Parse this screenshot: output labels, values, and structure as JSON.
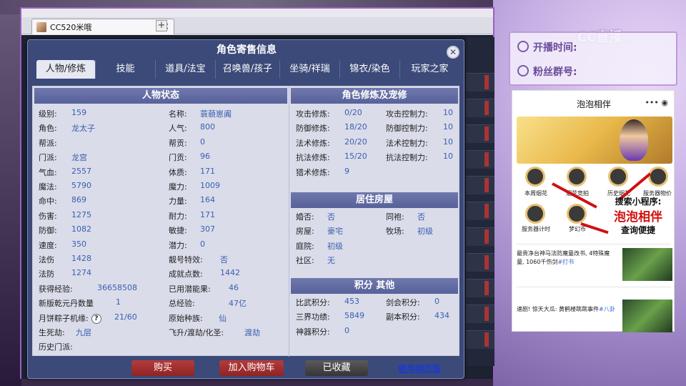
{
  "browser": {
    "tab_title": "CC520米哦",
    "close_glyph": "×",
    "new_tab_glyph": "+"
  },
  "dialog": {
    "title": "角色寄售信息",
    "close_glyph": "✕",
    "tabs": [
      "人物/修炼",
      "技能",
      "道具/法宝",
      "召唤兽/孩子",
      "坐骑/祥瑞",
      "锦衣/染色",
      "玩家之家"
    ],
    "active_tab": 0
  },
  "status": {
    "title": "人物状态",
    "left": [
      {
        "label": "级别:",
        "value": "159"
      },
      {
        "label": "角色:",
        "value": "龙太子"
      },
      {
        "label": "帮派:",
        "value": ""
      },
      {
        "label": "门派:",
        "value": "龙宫"
      },
      {
        "label": "气血:",
        "value": "2557"
      },
      {
        "label": "魔法:",
        "value": "5790"
      },
      {
        "label": "命中:",
        "value": "869"
      },
      {
        "label": "伤害:",
        "value": "1275"
      },
      {
        "label": "防御:",
        "value": "1082"
      },
      {
        "label": "速度:",
        "value": "350"
      },
      {
        "label": "法伤",
        "value": "1428"
      },
      {
        "label": "法防",
        "value": "1274"
      },
      {
        "label": "获得经验:",
        "value": "36658508"
      },
      {
        "label": "新版乾元丹数量",
        "value": "1"
      },
      {
        "label": "月饼粽子机缘:",
        "value": "21/60"
      },
      {
        "label": "生死劫:",
        "value": "九层"
      },
      {
        "label": "历史门派:",
        "value": ""
      }
    ],
    "right": [
      {
        "label": "名称:",
        "value": "蓑藐崽阗"
      },
      {
        "label": "人气:",
        "value": "800"
      },
      {
        "label": "帮贡:",
        "value": "0"
      },
      {
        "label": "门贡:",
        "value": "96"
      },
      {
        "label": "体质:",
        "value": "171"
      },
      {
        "label": "魔力:",
        "value": "1009"
      },
      {
        "label": "力量:",
        "value": "164"
      },
      {
        "label": "耐力:",
        "value": "171"
      },
      {
        "label": "敏捷:",
        "value": "307"
      },
      {
        "label": "潜力:",
        "value": "0"
      },
      {
        "label": "靓号特效:",
        "value": "否"
      },
      {
        "label": "成就点数:",
        "value": "1442"
      },
      {
        "label": "已用潜能果:",
        "value": "46"
      },
      {
        "label": "总经验:",
        "value": "47亿"
      },
      {
        "label": "原始种族:",
        "value": "仙"
      },
      {
        "label": "飞升/渡劫/化圣:",
        "value": "渡劫"
      }
    ],
    "help_glyph": "?"
  },
  "cultivation": {
    "title": "角色修炼及宠修",
    "left": [
      {
        "label": "攻击修炼:",
        "value": "0/20"
      },
      {
        "label": "防御修炼:",
        "value": "18/20"
      },
      {
        "label": "法术修炼:",
        "value": "20/20"
      },
      {
        "label": "抗法修炼:",
        "value": "15/20"
      },
      {
        "label": "猎术修炼:",
        "value": "9"
      }
    ],
    "right": [
      {
        "label": "攻击控制力:",
        "value": "10"
      },
      {
        "label": "防御控制力:",
        "value": "10"
      },
      {
        "label": "法术控制力:",
        "value": "10"
      },
      {
        "label": "抗法控制力:",
        "value": "10"
      }
    ]
  },
  "housing": {
    "title": "居住房屋",
    "left": [
      {
        "label": "婚否:",
        "value": "否"
      },
      {
        "label": "房屋:",
        "value": "豪宅"
      },
      {
        "label": "庭院:",
        "value": "初级"
      },
      {
        "label": "社区:",
        "value": "无"
      }
    ],
    "right": [
      {
        "label": "同袍:",
        "value": "否"
      },
      {
        "label": "牧场:",
        "value": "初级"
      }
    ]
  },
  "points": {
    "title": "积分 其他",
    "left": [
      {
        "label": "比武积分:",
        "value": "453"
      },
      {
        "label": "三界功绩:",
        "value": "5849"
      },
      {
        "label": "神器积分:",
        "value": "0"
      }
    ],
    "right": [
      {
        "label": "剑会积分:",
        "value": "0"
      },
      {
        "label": "副本积分:",
        "value": "434"
      }
    ]
  },
  "actions": {
    "buy": "购买",
    "cart": "加入购物车",
    "fav": "已收藏",
    "web": "使用网页版"
  },
  "overlay": {
    "logo": "CC直播",
    "live_time_label": "开播时间:",
    "fan_group_label": "粉丝群号:",
    "mini_title": "泡泡相伴",
    "mini_dots": "•••  ◉",
    "mini_icons": [
      "本周烟花",
      "烟花竞拍",
      "历史烟花",
      "服务器物价",
      "服务器计时",
      "梦幻币"
    ],
    "promo_line1": "搜索小程序:",
    "promo_line2": "泡泡相伴",
    "promo_line3": "查询便捷",
    "news": [
      {
        "text": "最贵净台神马法防魔童改书, 4特殊魔童, 1060千伤剑",
        "tag": "#打书"
      },
      {
        "text": "速剧! 惊天大瓜: 黄鹤楼跳跳事件",
        "tag": "#八卦"
      }
    ]
  },
  "colors": {
    "accent_purple": "#9a5fc0",
    "dialog_bg": "#3b4a78",
    "value_blue": "#3a5fb0",
    "buy_red": "#b53b3b"
  }
}
